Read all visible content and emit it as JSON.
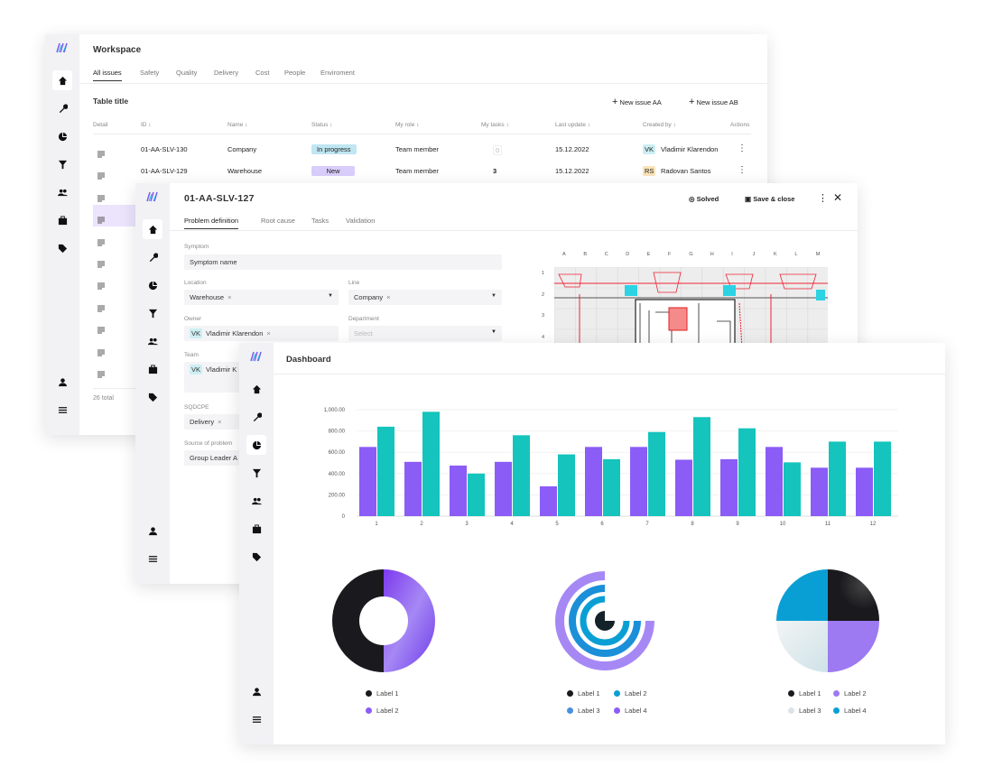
{
  "workspace": {
    "title": "Workspace",
    "tabs": [
      "All issues",
      "Safety",
      "Quality",
      "Delivery",
      "Cost",
      "People",
      "Enviroment"
    ],
    "table_title": "Table title",
    "new_issue_aa": "New issue AA",
    "new_issue_ab": "New issue AB",
    "columns": [
      "Detail",
      "ID ↕",
      "Name ↕",
      "Status ↕",
      "My role ↕",
      "My tasks ↕",
      "Last update ↕",
      "Created by ↕",
      "Actions"
    ],
    "rows": [
      {
        "id": "01-AA-SLV-130",
        "name": "Company",
        "status": "In progress",
        "role": "Team member",
        "tasks": "0",
        "updated": "15.12.2022",
        "initials": "VK",
        "creator": "Vladimir Klarendon"
      },
      {
        "id": "01-AA-SLV-129",
        "name": "Warehouse",
        "status": "New",
        "role": "Team member",
        "tasks": "3",
        "updated": "15.12.2022",
        "initials": "RS",
        "creator": "Radovan Santos"
      }
    ],
    "total": "26 total"
  },
  "issue": {
    "id": "01-AA-SLV-127",
    "solved": "Solved",
    "save_close": "Save & close",
    "tabs": [
      "Problem definition",
      "Root cause",
      "Tasks",
      "Validation"
    ],
    "symptom": {
      "label": "Symptom",
      "value": "Symptom name"
    },
    "location": {
      "label": "Location",
      "value": "Warehouse"
    },
    "line": {
      "label": "Line",
      "value": "Company"
    },
    "owner": {
      "label": "Owner",
      "initials": "VK",
      "value": "Vladimir Klarendon"
    },
    "department": {
      "label": "Department",
      "placeholder": "Select"
    },
    "team": {
      "label": "Team",
      "initials": "VK",
      "value": "Vladimir K"
    },
    "sqdcpe": {
      "label": "SQDCPE",
      "value": "Delivery"
    },
    "source": {
      "label": "Source of problem",
      "value": "Group Leader A"
    },
    "floorplan": {
      "columns": [
        "A",
        "B",
        "C",
        "D",
        "E",
        "F",
        "G",
        "H",
        "I",
        "J",
        "K",
        "L",
        "M"
      ],
      "rows": [
        "1",
        "2",
        "3",
        "4"
      ]
    }
  },
  "dashboard": {
    "title": "Dashboard"
  },
  "colors": {
    "purple": "#8b5cf6",
    "teal": "#14c4bd",
    "black": "#1a1a1e",
    "blue": "#0a9fd4",
    "lightblue": "#4a8fe0",
    "gray": "#dde2e6",
    "in_progress_bg": "#bfe6f2",
    "new_bg": "#d9cdfb",
    "vk_bg": "#cdeef3",
    "rs_bg": "#fbe3b8"
  },
  "chart_data": [
    {
      "type": "bar",
      "categories": [
        "1",
        "2",
        "3",
        "4",
        "5",
        "6",
        "7",
        "8",
        "9",
        "10",
        "11",
        "12"
      ],
      "series": [
        {
          "values": [
            650,
            510,
            475,
            510,
            280,
            650,
            650,
            530,
            535,
            650,
            455,
            455
          ],
          "color": "#8b5cf6"
        },
        {
          "values": [
            840,
            980,
            400,
            760,
            580,
            535,
            790,
            930,
            825,
            505,
            700,
            700
          ],
          "color": "#14c4bd"
        }
      ],
      "yticks": [
        "0",
        "200.00",
        "400.00",
        "600.00",
        "800.00",
        "1,000.00"
      ],
      "ylim": [
        0,
        1000
      ],
      "grid": true
    },
    {
      "type": "pie",
      "variant": "donut",
      "labels": [
        "Label 1",
        "Label 2"
      ],
      "values": [
        50,
        50
      ],
      "colors": [
        "#1a1a1e",
        "#8b5cf6"
      ]
    },
    {
      "type": "pie",
      "variant": "radial",
      "labels": [
        "Label 1",
        "Label 2",
        "Label 3",
        "Label 4"
      ],
      "values": [
        75,
        75,
        75,
        75
      ],
      "colors": [
        "#1a1a1e",
        "#0a9fd4",
        "#4a8fe0",
        "#8b5cf6"
      ]
    },
    {
      "type": "pie",
      "labels": [
        "Label 1",
        "Label 2",
        "Label 3",
        "Label 4"
      ],
      "values": [
        25,
        25,
        25,
        25
      ],
      "colors": [
        "#1a1a1e",
        "#9d7af2",
        "#dde2e6",
        "#0a9fd4"
      ]
    }
  ]
}
